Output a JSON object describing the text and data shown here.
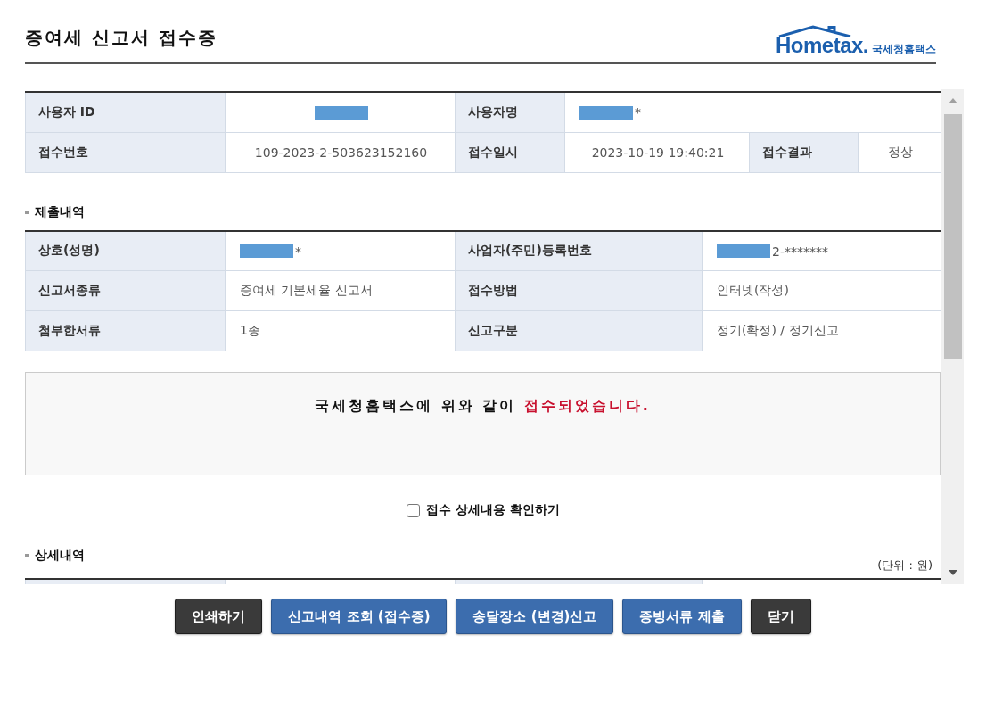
{
  "header": {
    "title": "증여세 신고서 접수증",
    "logo": {
      "wordmark": "Hometax.",
      "name": "국세청홈택스"
    }
  },
  "receipt": {
    "rows": [
      [
        {
          "kind": "label",
          "text": "사용자 ID"
        },
        {
          "kind": "value",
          "redacted": true
        },
        {
          "kind": "label",
          "text": "사용자명"
        },
        {
          "kind": "value",
          "text": "*",
          "redacted": true,
          "colspan": 3
        }
      ],
      [
        {
          "kind": "label",
          "text": "접수번호"
        },
        {
          "kind": "value",
          "text": "109-2023-2-503623152160",
          "redacted": false
        },
        {
          "kind": "label",
          "text": "접수일시"
        },
        {
          "kind": "value",
          "text": "2023-10-19 19:40:21",
          "redacted": false
        },
        {
          "kind": "label",
          "text": "접수결과"
        },
        {
          "kind": "value",
          "text": "정상",
          "redacted": false
        }
      ]
    ]
  },
  "submission": {
    "heading": "제출내역",
    "rows": [
      [
        {
          "kind": "label",
          "text": "상호(성명)"
        },
        {
          "kind": "value",
          "text": "*",
          "redacted": true
        },
        {
          "kind": "label",
          "text": "사업자(주민)등록번호"
        },
        {
          "kind": "value",
          "text": "2-*******",
          "redacted": true
        }
      ],
      [
        {
          "kind": "label",
          "text": "신고서종류"
        },
        {
          "kind": "value",
          "text": "증여세 기본세율 신고서",
          "redacted": false
        },
        {
          "kind": "label",
          "text": "접수방법"
        },
        {
          "kind": "value",
          "text": "인터넷(작성)",
          "redacted": false
        }
      ],
      [
        {
          "kind": "label",
          "text": "첨부한서류"
        },
        {
          "kind": "value",
          "text": "1종",
          "redacted": false
        },
        {
          "kind": "label",
          "text": "신고구분"
        },
        {
          "kind": "value",
          "text": "정기(확정) / 정기신고",
          "redacted": false
        }
      ]
    ]
  },
  "confirmation": {
    "message": "국세청홈택스에 위와 같이 **접수되었습니다.**"
  },
  "detail_toggle": {
    "label": "접수 상세내용 확인하기",
    "checked": false
  },
  "details": {
    "heading": "상세내역",
    "unit": "(단위 : 원)"
  },
  "buttons": [
    {
      "label": "인쇄하기",
      "kind": "dark"
    },
    {
      "label": "신고내역 조회 (접수증)",
      "kind": "primary"
    },
    {
      "label": "송달장소 (변경)신고",
      "kind": "primary"
    },
    {
      "label": "증빙서류 제출",
      "kind": "primary"
    },
    {
      "label": "닫기",
      "kind": "dark"
    }
  ]
}
